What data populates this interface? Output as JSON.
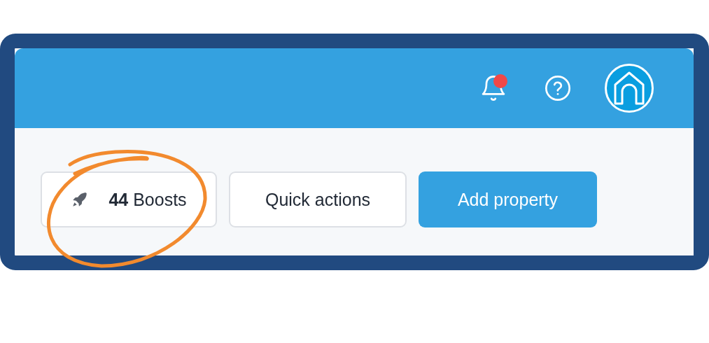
{
  "header": {
    "notifications": {
      "has_unread": true
    }
  },
  "actions": [
    {
      "kind": "boosts",
      "label": "**44** Boosts"
    },
    {
      "kind": "secondary",
      "label": "Quick actions"
    },
    {
      "kind": "primary",
      "label": "Add property"
    }
  ],
  "annotation": {
    "kind": "circle"
  }
}
